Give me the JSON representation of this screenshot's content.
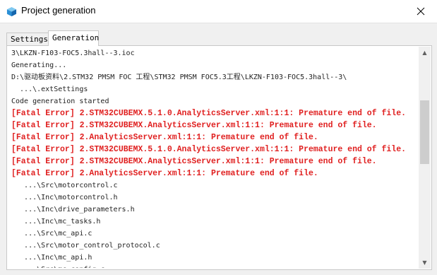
{
  "window": {
    "title": "Project generation",
    "app_icon": "cube-icon",
    "close_icon": "close-icon"
  },
  "tabs": [
    {
      "label": "Settings",
      "active": false
    },
    {
      "label": "Generation",
      "active": true
    }
  ],
  "console": {
    "lines": [
      {
        "text": "3\\LKZN-F103-FOC5.3hall--3.ioc",
        "type": "info"
      },
      {
        "text": "Generating...",
        "type": "info"
      },
      {
        "text": "D:\\驱动板资料\\2.STM32 PMSM FOC 工程\\STM32 PMSM FOC5.3工程\\LKZN-F103-FOC5.3hall--3\\",
        "type": "info"
      },
      {
        "text": "  ...\\.extSettings",
        "type": "info"
      },
      {
        "text": "Code generation started",
        "type": "info"
      },
      {
        "text": "[Fatal Error] 2.STM32CUBEMX.5.1.0.AnalyticsServer.xml:1:1: Premature end of file.",
        "type": "error"
      },
      {
        "text": "[Fatal Error] 2.STM32CUBEMX.AnalyticsServer.xml:1:1: Premature end of file.",
        "type": "error"
      },
      {
        "text": "[Fatal Error] 2.AnalyticsServer.xml:1:1: Premature end of file.",
        "type": "error"
      },
      {
        "text": "[Fatal Error] 2.STM32CUBEMX.5.1.0.AnalyticsServer.xml:1:1: Premature end of file.",
        "type": "error"
      },
      {
        "text": "[Fatal Error] 2.STM32CUBEMX.AnalyticsServer.xml:1:1: Premature end of file.",
        "type": "error"
      },
      {
        "text": "[Fatal Error] 2.AnalyticsServer.xml:1:1: Premature end of file.",
        "type": "error"
      },
      {
        "text": "   ...\\Src\\motorcontrol.c",
        "type": "info"
      },
      {
        "text": "   ...\\Inc\\motorcontrol.h",
        "type": "info"
      },
      {
        "text": "   ...\\Inc\\drive_parameters.h",
        "type": "info"
      },
      {
        "text": "   ...\\Inc\\mc_tasks.h",
        "type": "info"
      },
      {
        "text": "   ...\\Src\\mc_api.c",
        "type": "info"
      },
      {
        "text": "   ...\\Src\\motor_control_protocol.c",
        "type": "info"
      },
      {
        "text": "   ...\\Inc\\mc_api.h",
        "type": "info"
      },
      {
        "text": "   ...\\Src\\mc_config.c",
        "type": "info"
      }
    ]
  },
  "scrollbar": {
    "up_icon": "arrow-up-icon",
    "down_icon": "arrow-down-icon"
  }
}
